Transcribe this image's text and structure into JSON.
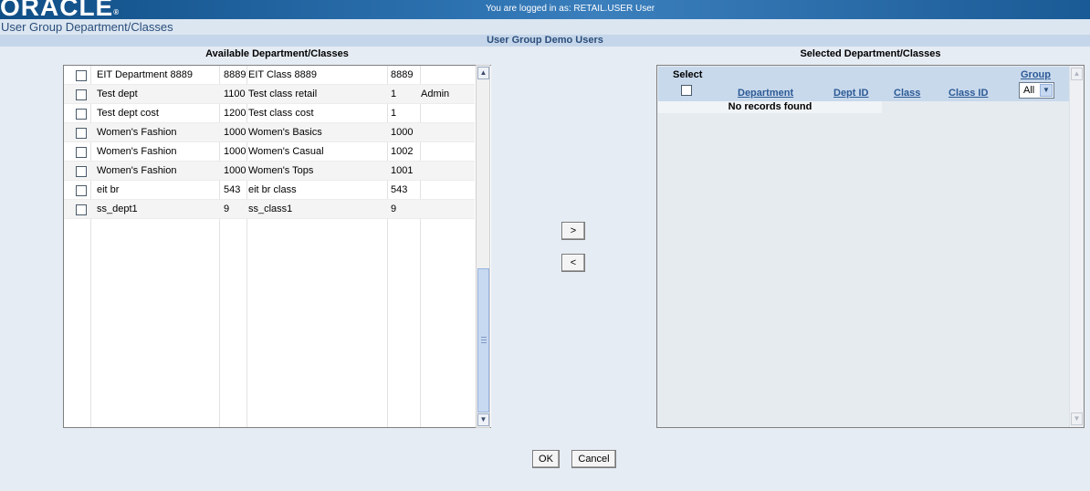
{
  "header": {
    "logo": "ORACLE",
    "logo_mark": "®",
    "login_text": "You are logged in as: RETAIL.USER User"
  },
  "page_title": "User Group Department/Classes",
  "user_group": "User Group Demo Users",
  "available": {
    "title": "Available Department/Classes",
    "rows": [
      {
        "dept": "EIT Department 8889",
        "dept_id": "8889",
        "class": "EIT Class 8889",
        "class_id": "8889",
        "group": ""
      },
      {
        "dept": "Test dept",
        "dept_id": "1100",
        "class": "Test class retail",
        "class_id": "1",
        "group": "Admin"
      },
      {
        "dept": "Test dept cost",
        "dept_id": "1200",
        "class": "Test class cost",
        "class_id": "1",
        "group": ""
      },
      {
        "dept": "Women's Fashion",
        "dept_id": "1000",
        "class": "Women's Basics",
        "class_id": "1000",
        "group": ""
      },
      {
        "dept": "Women's Fashion",
        "dept_id": "1000",
        "class": "Women's Casual",
        "class_id": "1002",
        "group": ""
      },
      {
        "dept": "Women's Fashion",
        "dept_id": "1000",
        "class": "Women's Tops",
        "class_id": "1001",
        "group": ""
      },
      {
        "dept": "eit br",
        "dept_id": "543",
        "class": "eit br class",
        "class_id": "543",
        "group": ""
      },
      {
        "dept": "ss_dept1",
        "dept_id": "9",
        "class": "ss_class1",
        "class_id": "9",
        "group": ""
      }
    ]
  },
  "move_buttons": {
    "add": ">",
    "remove": "<"
  },
  "selected": {
    "title": "Selected Department/Classes",
    "columns": {
      "select": "Select",
      "department": "Department",
      "dept_id": "Dept ID",
      "class": "Class",
      "class_id": "Class ID",
      "group": "Group"
    },
    "group_filter": "All",
    "empty_message": "No records found"
  },
  "footer": {
    "ok": "OK",
    "cancel": "Cancel"
  }
}
